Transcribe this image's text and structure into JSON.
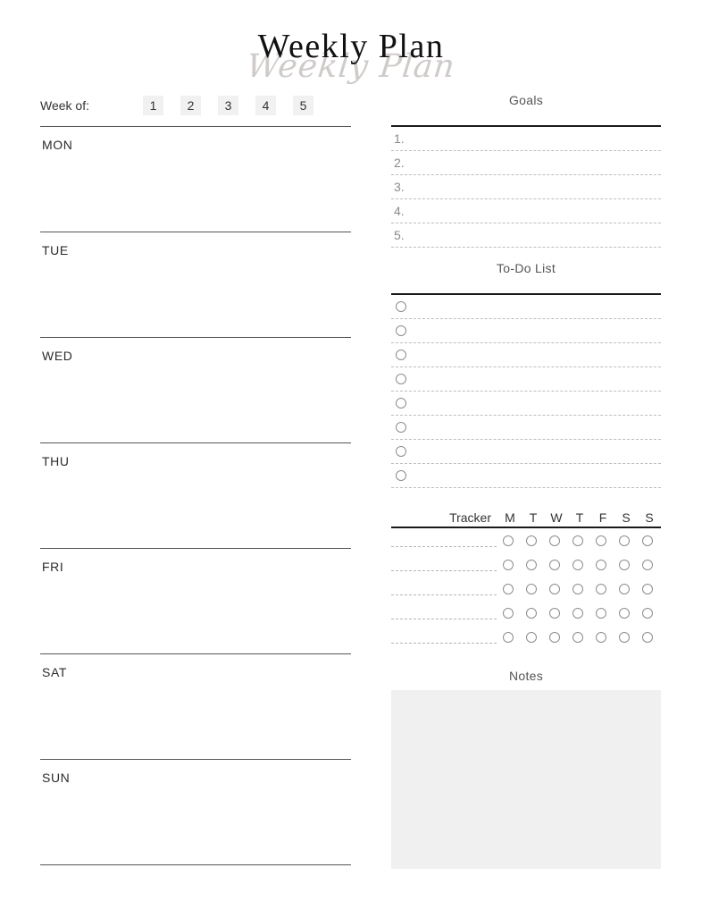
{
  "title": {
    "main": "Weekly Plan",
    "script_overlay": "Weekly Plan"
  },
  "week_of": {
    "label": "Week of:",
    "boxes": [
      "1",
      "2",
      "3",
      "4",
      "5"
    ]
  },
  "days": [
    {
      "label": "MON"
    },
    {
      "label": "TUE"
    },
    {
      "label": "WED"
    },
    {
      "label": "THU"
    },
    {
      "label": "FRI"
    },
    {
      "label": "SAT"
    },
    {
      "label": "SUN"
    }
  ],
  "goals": {
    "title": "Goals",
    "rows": [
      "1.",
      "2.",
      "3.",
      "4.",
      "5."
    ]
  },
  "todo": {
    "title": "To-Do List",
    "row_count": 8,
    "checkbox_icon": "circle-checkbox-icon"
  },
  "tracker": {
    "title": "Tracker",
    "day_headers": [
      "M",
      "T",
      "W",
      "T",
      "F",
      "S",
      "S"
    ],
    "row_count": 5,
    "cell_icon": "circle-checkbox-icon"
  },
  "notes": {
    "title": "Notes",
    "fill_color": "#f0f0f0"
  },
  "colors": {
    "page_background": "#ffffff",
    "text": "#2b2b2b",
    "muted_text": "#8a8a8a",
    "section_title": "#555555",
    "rule": "#555555",
    "dotted_rule": "#bdbdbd",
    "box_fill": "#f1f1f1",
    "script_overlay": "#cfcbc9"
  }
}
